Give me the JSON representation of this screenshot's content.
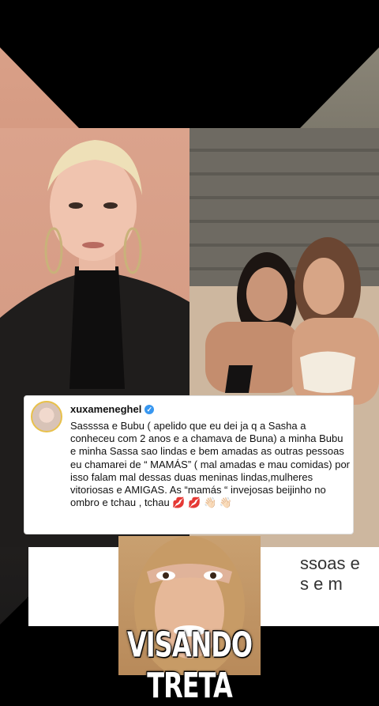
{
  "post": {
    "username": "xuxameneghel",
    "verified_icon": "check-badge-icon",
    "caption": "Sassssa e Bubu ( apelido que eu dei ja q a Sasha a conheceu com 2 anos e a chamava de Buna) a minha Bubu e minha Sassa sao lindas e bem amadas as outras pessoas eu chamarei de “ MAMÁS” ( mal amadas e mau comidas) por isso falam mal dessas duas meninas lindas,mulheres vitoriosas e AMIGAS.  As “mamás “ invejosas beijinho no ombro e tchau , tchau 💋 💋 👋🏻 👋🏻"
  },
  "bottom": {
    "partial_text": "ssoas e\ns e m"
  },
  "branding": {
    "title": "VISANDO TRETA"
  },
  "colors": {
    "verified": "#3897f0",
    "avatar_ring": "#e8c14b"
  }
}
